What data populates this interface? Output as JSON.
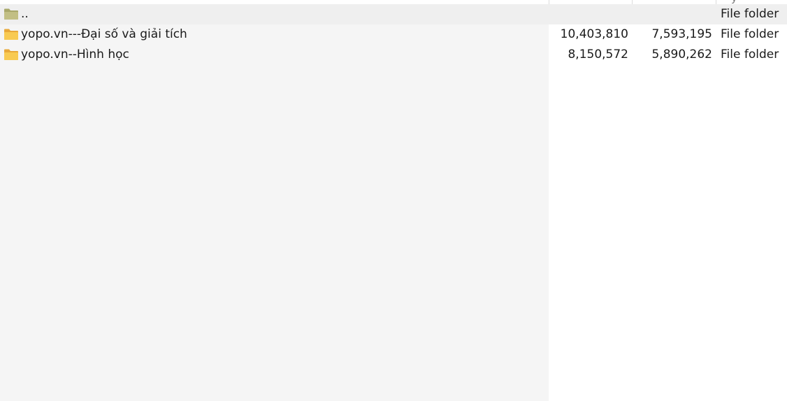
{
  "header": {
    "type_glyph": "y"
  },
  "rows": [
    {
      "icon": "folder-up-icon",
      "name": "..",
      "size": "",
      "packed": "",
      "type": "File folder"
    },
    {
      "icon": "folder-icon",
      "name": "yopo.vn---Đại số và giải tích",
      "size": "10,403,810",
      "packed": "7,593,195",
      "type": "File folder"
    },
    {
      "icon": "folder-icon",
      "name": "yopo.vn--Hình học",
      "size": "8,150,572",
      "packed": "5,890,262",
      "type": "File folder"
    }
  ],
  "colors": {
    "name_column_bg": "#f5f5f5",
    "selected_row_bg": "#efefef",
    "folder_yellow": "#f6c544",
    "parent_folder": "#b9b67a"
  }
}
